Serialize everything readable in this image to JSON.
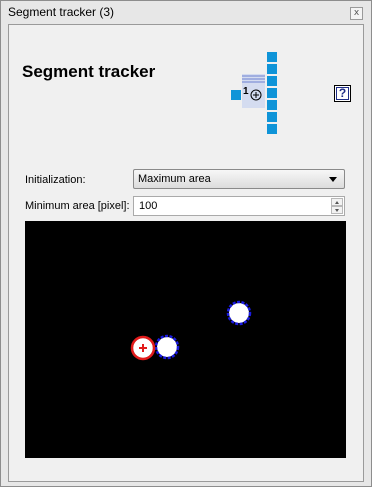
{
  "window": {
    "title": "Segment tracker (3)",
    "close_label": "x"
  },
  "header": {
    "title": "Segment tracker",
    "logo_icon": "segment-tracker-logo-icon",
    "logo_number": "1",
    "help_label": "?"
  },
  "form": {
    "initialization_label": "Initialization:",
    "initialization_value": "Maximum area",
    "min_area_label": "Minimum area [pixel]:",
    "min_area_value": "100"
  },
  "colors": {
    "accent": "#0f94d8",
    "tracked": "#e21b1b",
    "detected": "#1b1be2"
  }
}
